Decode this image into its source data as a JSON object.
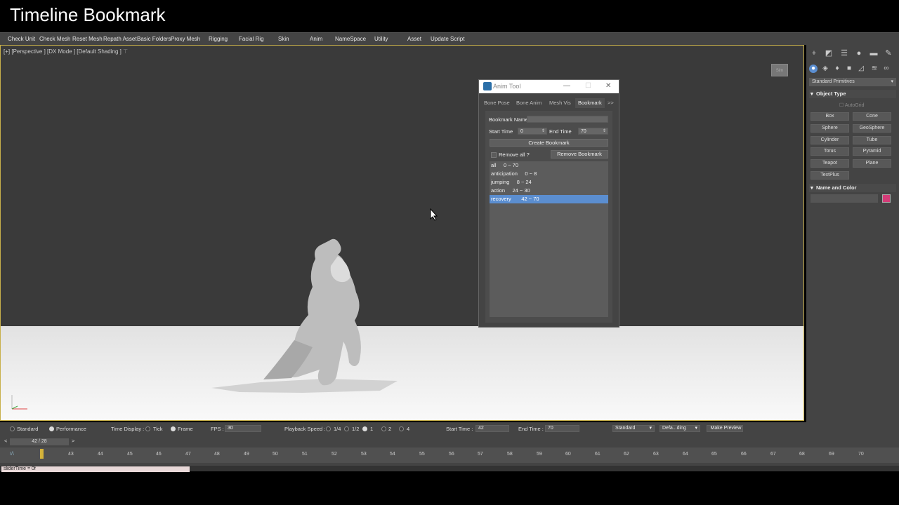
{
  "title": "Timeline Bookmark",
  "menubar": [
    "Check Unit",
    "Check Mesh",
    "Reset Mesh",
    "Repath Asset",
    "Basic Folders",
    "Proxy Mesh",
    "Rigging",
    "Facial Rig",
    "Skin",
    "Anim",
    "NameSpace",
    "Utility",
    "Asset",
    "Update Script"
  ],
  "viewport": {
    "label": "[+] [Perspective ] [DX Mode ] [Default Shading ]",
    "filter_icon": "filter-icon",
    "viewcube_label": "Sim"
  },
  "anim_tool": {
    "title": "Anim Tool",
    "minimize": "—",
    "maximize": "☐",
    "close": "✕",
    "tabs": [
      "Bone Pose",
      "Bone Anim",
      "Mesh Vis",
      "Bookmark",
      ">>"
    ],
    "active_tab": "Bookmark",
    "bookmark_name_label": "Bookmark Name",
    "bookmark_name_value": "",
    "start_time_label": "Start Time",
    "start_time_value": "0",
    "end_time_label": "End Time",
    "end_time_value": "70",
    "create_button": "Create Bookmark",
    "remove_all_label": "Remove all ?",
    "remove_button": "Remove Bookmark",
    "bookmarks": [
      {
        "name": "all",
        "range": "0 ~ 70"
      },
      {
        "name": "anticipation",
        "range": "0 ~ 8"
      },
      {
        "name": "jumping",
        "range": "8 ~ 24"
      },
      {
        "name": "action",
        "range": "24 ~ 30"
      },
      {
        "name": "recovery",
        "range": "42 ~ 70"
      }
    ],
    "selected_bookmark": "recovery"
  },
  "command_panel": {
    "dropdown": "Standard Primitives",
    "object_type_label": "Object Type",
    "autogrid_label": "AutoGrid",
    "primitives": [
      "Box",
      "Cone",
      "Sphere",
      "GeoSphere",
      "Cylinder",
      "Tube",
      "Torus",
      "Pyramid",
      "Teapot",
      "Plane",
      "TextPlus"
    ],
    "name_color_label": "Name and Color",
    "swatch_color": "#d43c78"
  },
  "bottom": {
    "standard_label": "Standard",
    "performance_label": "Performance",
    "time_display_label": "Time Display :",
    "tick_label": "Tick",
    "frame_label": "Frame",
    "fps_label": "FPS :",
    "fps_value": "30",
    "playback_label": "Playback Speed :",
    "speed_quarter": "1/4",
    "speed_half": "1/2",
    "speed_1": "1",
    "speed_2": "2",
    "speed_4": "4",
    "start_time_label": "Start Time :",
    "start_time_value": "42",
    "end_time_label": "End Time :",
    "end_time_value": "70",
    "dropdown_standard": "Standard",
    "dropdown_shading": "Defa...ding",
    "make_preview": "Make Preview",
    "frame_counter": "42 / 28",
    "prev": "<",
    "next": ">",
    "ticks": [
      "43",
      "44",
      "45",
      "46",
      "47",
      "48",
      "49",
      "50",
      "51",
      "52",
      "53",
      "54",
      "55",
      "56",
      "57",
      "58",
      "59",
      "60",
      "61",
      "62",
      "63",
      "64",
      "65",
      "66",
      "67",
      "68",
      "69",
      "70"
    ],
    "maxscript": "sliderTime = 0f"
  }
}
